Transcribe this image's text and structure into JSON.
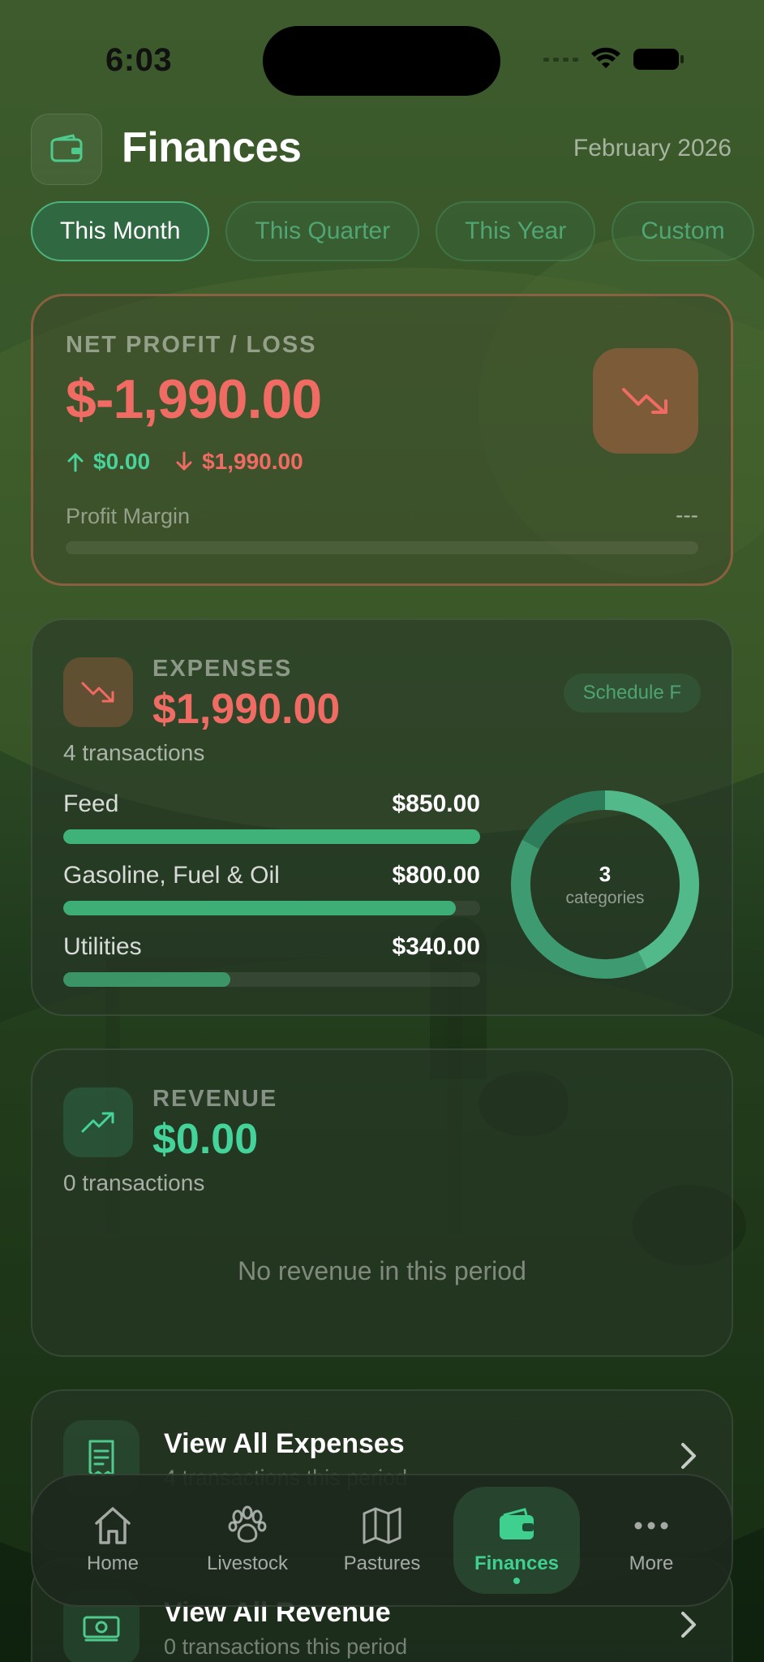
{
  "status_bar": {
    "time": "6:03"
  },
  "header": {
    "title": "Finances",
    "period": "February 2026"
  },
  "filters": [
    {
      "label": "This Month",
      "active": true
    },
    {
      "label": "This Quarter",
      "active": false
    },
    {
      "label": "This Year",
      "active": false
    },
    {
      "label": "Custom",
      "active": false
    }
  ],
  "net_profit": {
    "label": "NET PROFIT / LOSS",
    "value": "$-1,990.00",
    "income": "$0.00",
    "expense": "$1,990.00",
    "margin_label": "Profit Margin",
    "margin_value": "---"
  },
  "expenses": {
    "label": "EXPENSES",
    "total": "$1,990.00",
    "tx_count": "4 transactions",
    "badge": "Schedule F",
    "categories": [
      {
        "name": "Feed",
        "amount": "$850.00",
        "value": 850
      },
      {
        "name": "Gasoline, Fuel & Oil",
        "amount": "$800.00",
        "value": 800
      },
      {
        "name": "Utilities",
        "amount": "$340.00",
        "value": 340
      }
    ],
    "donut_count": "3",
    "donut_label": "categories"
  },
  "revenue": {
    "label": "REVENUE",
    "total": "$0.00",
    "tx_count": "0 transactions",
    "empty": "No revenue in this period"
  },
  "links": [
    {
      "title": "View All Expenses",
      "subtitle": "4 transactions this period"
    },
    {
      "title": "View All Revenue",
      "subtitle": "0 transactions this period"
    }
  ],
  "tabs": [
    {
      "label": "Home",
      "icon": "home-icon"
    },
    {
      "label": "Livestock",
      "icon": "paw-icon"
    },
    {
      "label": "Pastures",
      "icon": "map-icon"
    },
    {
      "label": "Finances",
      "icon": "wallet-icon",
      "active": true
    },
    {
      "label": "More",
      "icon": "more-icon"
    }
  ],
  "colors": {
    "loss": "#f06b63",
    "gain": "#43d39b",
    "accent": "#3fcf8f"
  }
}
